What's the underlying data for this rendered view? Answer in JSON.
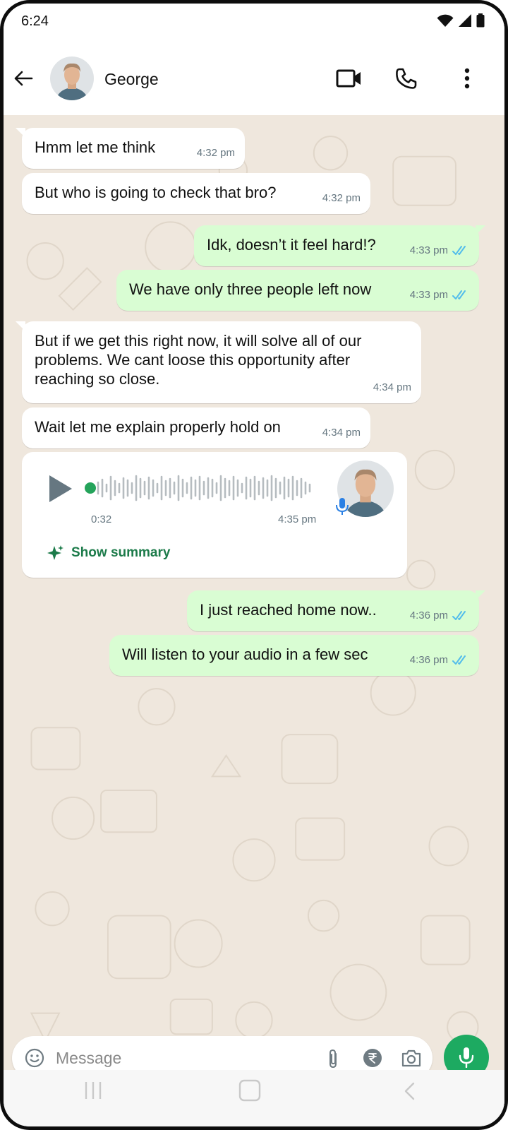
{
  "status_bar": {
    "time": "6:24"
  },
  "header": {
    "contact_name": "George"
  },
  "messages": [
    {
      "dir": "in",
      "text": "Hmm let me think",
      "time": "4:32 pm"
    },
    {
      "dir": "in",
      "text": "But who is going to check that bro?",
      "time": "4:32 pm"
    },
    {
      "dir": "out",
      "text": "Idk, doesn’t it feel hard!?",
      "time": "4:33 pm",
      "read": true
    },
    {
      "dir": "out",
      "text": "We have only three people left now",
      "time": "4:33 pm",
      "read": true
    },
    {
      "dir": "in",
      "text": "But if we get this right now, it will solve all of our problems. We cant loose this opportunity after reaching so close.",
      "time": "4:34 pm"
    },
    {
      "dir": "in",
      "text": "Wait let me explain properly hold on",
      "time": "4:34 pm"
    },
    {
      "dir": "in",
      "type": "voice",
      "duration": "0:32",
      "time": "4:35 pm",
      "summary_label": "Show summary"
    },
    {
      "dir": "out",
      "text": "I just reached home now..",
      "time": "4:36 pm",
      "read": true
    },
    {
      "dir": "out",
      "text": "Will listen to your audio in a few sec",
      "time": "4:36 pm",
      "read": true
    }
  ],
  "composer": {
    "placeholder": "Message"
  },
  "colors": {
    "incoming_bubble": "#ffffff",
    "outgoing_bubble": "#d9fdd3",
    "chat_background": "#efe7dd",
    "accent_green": "#1daa61",
    "read_tick": "#53bdeb",
    "summary_text": "#1c7b4a"
  },
  "icons": [
    "wifi-icon",
    "signal-icon",
    "battery-icon",
    "back-arrow-icon",
    "video-call-icon",
    "phone-call-icon",
    "more-options-icon",
    "play-icon",
    "mic-icon",
    "sparkle-icon",
    "emoji-icon",
    "attach-icon",
    "rupee-icon",
    "camera-icon",
    "nav-recent-icon",
    "nav-home-icon",
    "nav-back-icon"
  ]
}
